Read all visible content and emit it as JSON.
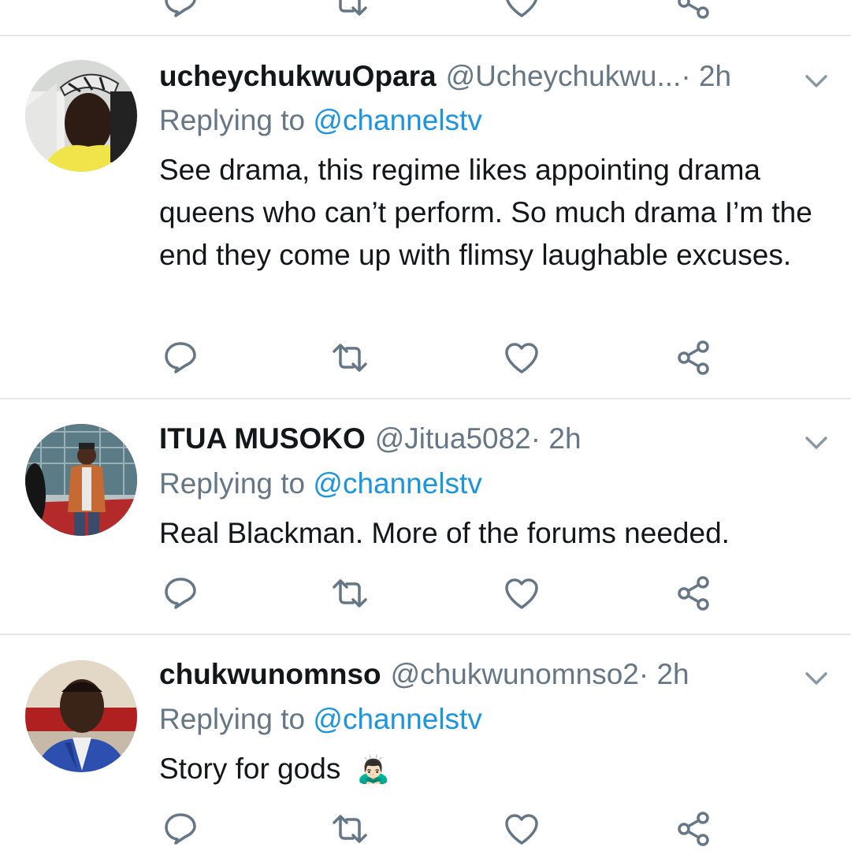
{
  "replying_label": "Replying to",
  "tweets": [
    {
      "display_name": "ucheychukwuOpara",
      "handle": "@Ucheychukwu...",
      "time": " · 2h",
      "replying_to": "@channelstv",
      "text": "See drama, this regime likes appointing drama queens who can’t perform. So much drama I’m the end they come up with flimsy laughable excuses."
    },
    {
      "display_name": "ITUA MUSOKO",
      "handle": "@Jitua5082",
      "time": " · 2h",
      "replying_to": "@channelstv",
      "text": "Real Blackman. More of the forums needed."
    },
    {
      "display_name": "chukwunomnso",
      "handle": "@chukwunomnso2",
      "time": " · 2h",
      "replying_to": "@channelstv",
      "text": "Story for gods",
      "emoji": "🙇🏻‍♂️"
    }
  ],
  "icons": {
    "reply": "reply-icon",
    "retweet": "retweet-icon",
    "like": "heart-icon",
    "share": "share-icon",
    "more": "chevron-down-icon"
  },
  "colors": {
    "name": "#14171a",
    "secondary": "#657786",
    "link": "#1b95e0",
    "divider": "#e3e7ea"
  }
}
